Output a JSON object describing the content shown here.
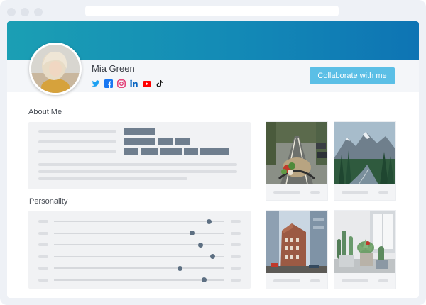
{
  "profile": {
    "name": "Mia Green",
    "collab_label": "Collaborate with me",
    "social_icons": [
      "twitter-icon",
      "facebook-icon",
      "instagram-icon",
      "linkedin-icon",
      "youtube-icon",
      "tiktok-icon"
    ]
  },
  "about": {
    "title": "About Me"
  },
  "personality": {
    "title": "Personality",
    "levels": [
      0.91,
      0.81,
      0.86,
      0.93,
      0.74,
      0.88
    ]
  },
  "colors": {
    "banner_start": "#1b9fb4",
    "banner_end": "#0e74b4",
    "button": "#5bbfe6",
    "tag": "#6f7e8e",
    "knob": "#5d6f82"
  }
}
